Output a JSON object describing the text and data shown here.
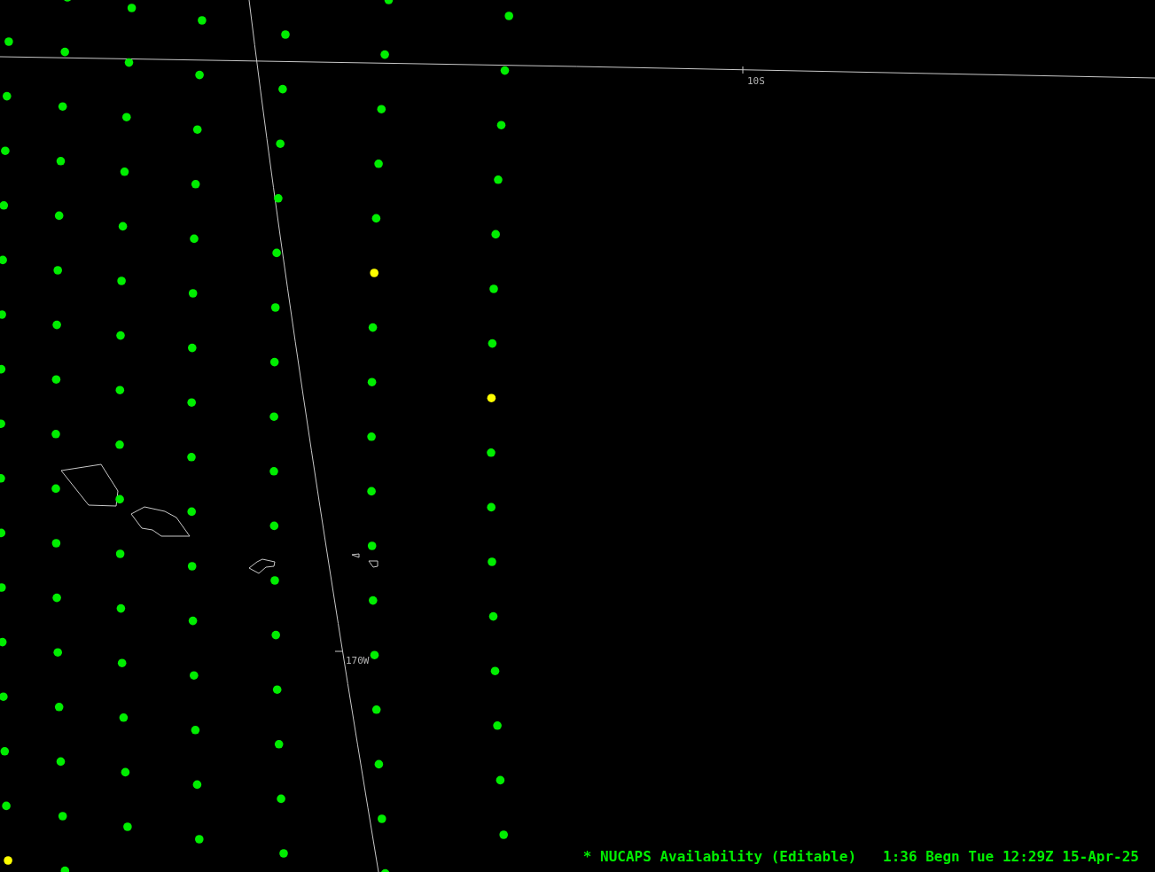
{
  "map": {
    "latitude_label": "10S",
    "longitude_label": "170W"
  },
  "columns": [
    {
      "points": [
        {
          "color": "#00ee00"
        },
        {
          "color": "#00ee00"
        },
        {
          "color": "#00ee00"
        },
        {
          "color": "#00ee00"
        },
        {
          "color": "#00ee00"
        },
        {
          "color": "#00ee00"
        },
        {
          "color": "#00ee00"
        },
        {
          "color": "#00ee00"
        },
        {
          "color": "#00ee00"
        },
        {
          "color": "#00ee00"
        },
        {
          "color": "#00ee00"
        },
        {
          "color": "#00ee00"
        },
        {
          "color": "#00ee00"
        },
        {
          "color": "#00ee00"
        },
        {
          "color": "#00ee00"
        },
        {
          "color": "#ffff00"
        }
      ]
    },
    {
      "points": [
        {
          "color": "#00ee00"
        },
        {
          "color": "#00ee00"
        },
        {
          "color": "#00ee00"
        },
        {
          "color": "#00ee00"
        },
        {
          "color": "#00ee00"
        },
        {
          "color": "#00ee00"
        },
        {
          "color": "#00ee00"
        },
        {
          "color": "#00ee00"
        },
        {
          "color": "#00ee00"
        },
        {
          "color": "#00ee00"
        },
        {
          "color": "#00ee00"
        },
        {
          "color": "#00ee00"
        },
        {
          "color": "#00ee00"
        },
        {
          "color": "#00ee00"
        },
        {
          "color": "#00ee00"
        },
        {
          "color": "#00ee00"
        },
        {
          "color": "#00ee00"
        }
      ]
    },
    {
      "points": [
        {
          "color": "#00ee00"
        },
        {
          "color": "#00ee00"
        },
        {
          "color": "#00ee00"
        },
        {
          "color": "#00ee00"
        },
        {
          "color": "#00ee00"
        },
        {
          "color": "#00ee00"
        },
        {
          "color": "#00ee00"
        },
        {
          "color": "#00ee00"
        },
        {
          "color": "#00ee00"
        },
        {
          "color": "#00ee00"
        },
        {
          "color": "#00ee00"
        },
        {
          "color": "#00ee00"
        },
        {
          "color": "#00ee00"
        },
        {
          "color": "#00ee00"
        },
        {
          "color": "#00ee00"
        },
        {
          "color": "#00ee00"
        }
      ]
    },
    {
      "points": [
        {
          "color": "#00ee00"
        },
        {
          "color": "#00ee00"
        },
        {
          "color": "#00ee00"
        },
        {
          "color": "#00ee00"
        },
        {
          "color": "#00ee00"
        },
        {
          "color": "#00ee00"
        },
        {
          "color": "#00ee00"
        },
        {
          "color": "#00ee00"
        },
        {
          "color": "#00ee00"
        },
        {
          "color": "#00ee00"
        },
        {
          "color": "#00ee00"
        },
        {
          "color": "#00ee00"
        },
        {
          "color": "#00ee00"
        },
        {
          "color": "#00ee00"
        },
        {
          "color": "#00ee00"
        },
        {
          "color": "#00ee00"
        }
      ]
    },
    {
      "points": [
        {
          "color": "#00ee00"
        },
        {
          "color": "#00ee00"
        },
        {
          "color": "#00ee00"
        },
        {
          "color": "#00ee00"
        },
        {
          "color": "#00ee00"
        },
        {
          "color": "#00ee00"
        },
        {
          "color": "#00ee00"
        },
        {
          "color": "#00ee00"
        },
        {
          "color": "#00ee00"
        },
        {
          "color": "#00ee00"
        },
        {
          "color": "#00ee00"
        },
        {
          "color": "#00ee00"
        },
        {
          "color": "#00ee00"
        },
        {
          "color": "#00ee00"
        },
        {
          "color": "#00ee00"
        },
        {
          "color": "#00ee00"
        }
      ]
    },
    {
      "points": [
        {
          "color": "#00ee00"
        },
        {
          "color": "#00ee00"
        },
        {
          "color": "#00ee00"
        },
        {
          "color": "#00ee00"
        },
        {
          "color": "#00ee00"
        },
        {
          "color": "#ffff00"
        },
        {
          "color": "#00ee00"
        },
        {
          "color": "#00ee00"
        },
        {
          "color": "#00ee00"
        },
        {
          "color": "#00ee00"
        },
        {
          "color": "#00ee00"
        },
        {
          "color": "#00ee00"
        },
        {
          "color": "#00ee00"
        },
        {
          "color": "#00ee00"
        },
        {
          "color": "#00ee00"
        },
        {
          "color": "#00ee00"
        },
        {
          "color": "#00ee00"
        }
      ]
    },
    {
      "points": [
        {
          "color": "#00ee00"
        },
        {
          "color": "#00ee00"
        },
        {
          "color": "#00ee00"
        },
        {
          "color": "#00ee00"
        },
        {
          "color": "#00ee00"
        },
        {
          "color": "#00ee00"
        },
        {
          "color": "#00ee00"
        },
        {
          "color": "#ffff00"
        },
        {
          "color": "#00ee00"
        },
        {
          "color": "#00ee00"
        },
        {
          "color": "#00ee00"
        },
        {
          "color": "#00ee00"
        },
        {
          "color": "#00ee00"
        },
        {
          "color": "#00ee00"
        },
        {
          "color": "#00ee00"
        },
        {
          "color": "#00ee00"
        }
      ]
    }
  ],
  "legend": {
    "product": "* NUCAPS Availability (Editable)",
    "frame_time": "1:36 Begn Tue 12:29Z 15-Apr-25"
  }
}
